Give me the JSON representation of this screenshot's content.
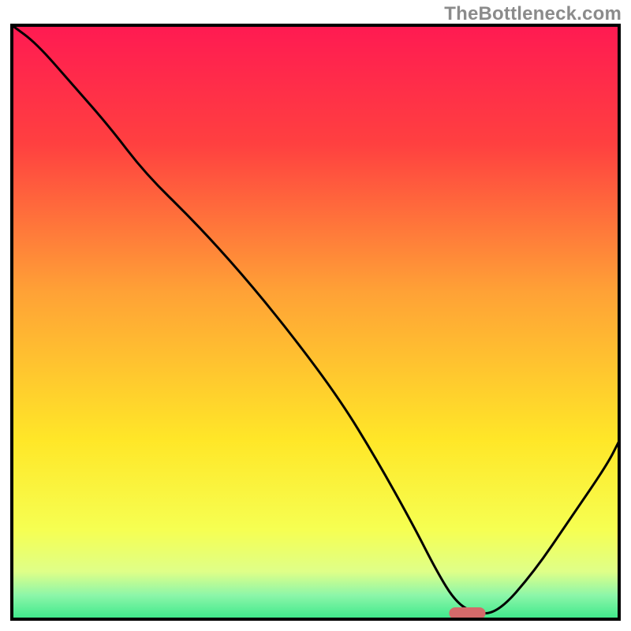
{
  "watermark": "TheBottleneck.com",
  "chart_data": {
    "type": "line",
    "title": "",
    "xlabel": "",
    "ylabel": "",
    "xlim": [
      0,
      100
    ],
    "ylim": [
      0,
      100
    ],
    "grid": false,
    "background_gradient_stops": [
      {
        "offset": 0.0,
        "color": "#ff1a52"
      },
      {
        "offset": 0.2,
        "color": "#ff4040"
      },
      {
        "offset": 0.45,
        "color": "#ffa236"
      },
      {
        "offset": 0.7,
        "color": "#ffe728"
      },
      {
        "offset": 0.85,
        "color": "#f6ff52"
      },
      {
        "offset": 0.92,
        "color": "#dfff88"
      },
      {
        "offset": 0.96,
        "color": "#8cf6a9"
      },
      {
        "offset": 1.0,
        "color": "#3ce88a"
      }
    ],
    "frame_color": "#000000",
    "series": [
      {
        "name": "bottleneck-curve",
        "color": "#000000",
        "stroke_width": 3,
        "x": [
          0,
          4,
          10,
          16,
          22,
          30,
          38,
          46,
          54,
          60,
          66,
          70,
          73,
          76,
          80,
          86,
          92,
          98,
          100
        ],
        "y": [
          100,
          97,
          90,
          83,
          75,
          67,
          58,
          48,
          37,
          27,
          16,
          8,
          3,
          1,
          1,
          8,
          17,
          26,
          30
        ]
      }
    ],
    "marker": {
      "name": "selected-point",
      "x": 75,
      "y": 1,
      "width": 6,
      "height": 2,
      "color": "#d46a6a",
      "shape": "rounded-rect"
    }
  }
}
